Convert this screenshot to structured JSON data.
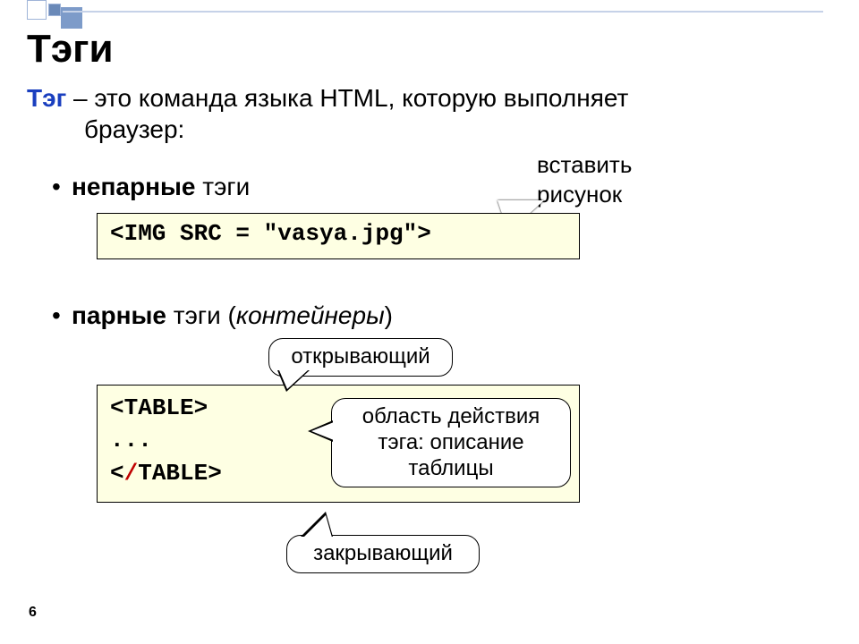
{
  "title": "Тэги",
  "definition": {
    "term": "Тэг",
    "body_line1": " – это команда языка HTML, которую выполняет",
    "body_line2": "браузер:"
  },
  "bullets": {
    "unpaired_bold": "непарные",
    "unpaired_rest": " тэги",
    "paired_bold": "парные",
    "paired_rest": " тэги (",
    "paired_italic": "контейнеры",
    "paired_close": ")"
  },
  "code1": {
    "text": "<IMG SRC = \"vasya.jpg\">"
  },
  "code2": {
    "open_lt": "<",
    "open_tag": "TABLE",
    "open_gt": ">",
    "dots": "...",
    "close_lt": "<",
    "close_slash": "/",
    "close_tag": "TABLE",
    "close_gt": ">"
  },
  "callouts": {
    "insert_pic_l1": "вставить",
    "insert_pic_l2": "рисунок",
    "opening": "открывающий",
    "area_l1": "область действия",
    "area_l2": "тэга: описание",
    "area_l3": "таблицы",
    "closing": "закрывающий"
  },
  "page_number": "6"
}
